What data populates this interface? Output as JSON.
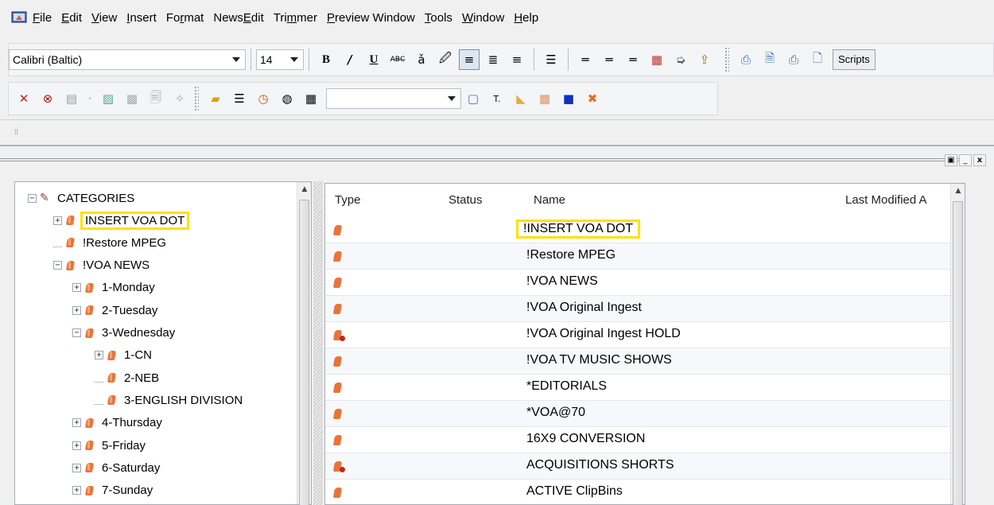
{
  "menu": [
    {
      "pre": "",
      "u": "F",
      "post": "ile"
    },
    {
      "pre": "",
      "u": "E",
      "post": "dit"
    },
    {
      "pre": "",
      "u": "V",
      "post": "iew"
    },
    {
      "pre": "",
      "u": "I",
      "post": "nsert"
    },
    {
      "pre": "Fo",
      "u": "r",
      "post": "mat"
    },
    {
      "pre": "News",
      "u": "E",
      "post": "dit"
    },
    {
      "pre": "Tri",
      "u": "m",
      "post": "mer"
    },
    {
      "pre": "",
      "u": "P",
      "post": "review Window"
    },
    {
      "pre": "",
      "u": "T",
      "post": "ools"
    },
    {
      "pre": "",
      "u": "W",
      "post": "indow"
    },
    {
      "pre": "",
      "u": "H",
      "post": "elp"
    }
  ],
  "toolbar": {
    "font_name": "Calibri (Baltic)",
    "font_size": "14",
    "bold": "B",
    "italic": "/",
    "underline": "U",
    "scripts": "Scripts"
  },
  "window": {
    "restore_icon": "▣",
    "minimize_icon": "_",
    "close_icon": "x"
  },
  "tree": {
    "root": "CATEGORIES",
    "items": [
      {
        "label": "INSERT VOA DOT",
        "highlight": true
      },
      {
        "label": "!Restore MPEG"
      },
      {
        "label": "!VOA NEWS"
      },
      {
        "label": "1-Monday"
      },
      {
        "label": "2-Tuesday"
      },
      {
        "label": "3-Wednesday"
      },
      {
        "label": "1-CN"
      },
      {
        "label": "2-NEB"
      },
      {
        "label": "3-ENGLISH DIVISION"
      },
      {
        "label": "4-Thursday"
      },
      {
        "label": "5-Friday"
      },
      {
        "label": "6-Saturday"
      },
      {
        "label": "7-Sunday"
      }
    ]
  },
  "list": {
    "columns": [
      "Type",
      "Status",
      "Name",
      "Last Modified A"
    ],
    "rows": [
      {
        "name": "!INSERT VOA DOT",
        "icon": "bin-icon",
        "highlight": true
      },
      {
        "name": "!Restore MPEG",
        "icon": "bin-icon"
      },
      {
        "name": "!VOA NEWS",
        "icon": "bin-icon"
      },
      {
        "name": "!VOA Original Ingest",
        "icon": "bin-icon"
      },
      {
        "name": "!VOA Original Ingest HOLD",
        "icon": "bin-hold-icon"
      },
      {
        "name": "!VOA TV MUSIC SHOWS",
        "icon": "bin-icon"
      },
      {
        "name": "*EDITORIALS",
        "icon": "bin-icon"
      },
      {
        "name": "*VOA@70",
        "icon": "bin-icon"
      },
      {
        "name": "16X9 CONVERSION",
        "icon": "bin-icon"
      },
      {
        "name": "ACQUISITIONS SHORTS",
        "icon": "bin-hold-icon"
      },
      {
        "name": "ACTIVE ClipBins",
        "icon": "bin-icon"
      }
    ]
  },
  "colors": {
    "highlight": "#ffe100",
    "bin": "#e8743a",
    "hold_dot": "#c0281c"
  }
}
